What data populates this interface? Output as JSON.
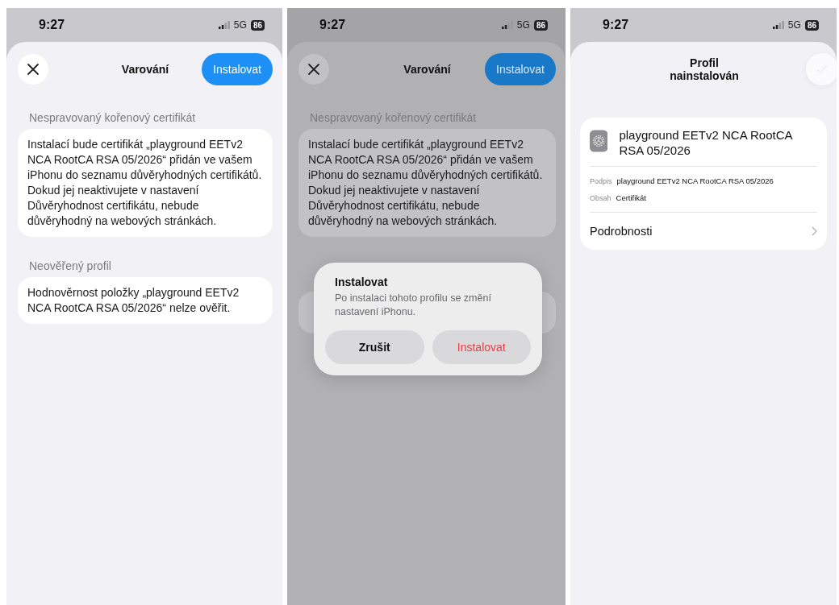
{
  "screens": [
    {
      "kind": "warning",
      "dimmed": false,
      "status": {
        "time": "9:27",
        "network": "5G",
        "battery": "86"
      },
      "title": "Varování",
      "install_button": "Instalovat",
      "sections": [
        {
          "header": "Nespravovaný kořenový certifikát",
          "text": "Instalací bude certifikát „playground EETv2 NCA RootCA RSA 05/2026“ přidán ve vašem iPhonu do seznamu důvěryhodných certifikátů. Dokud jej neaktivujete v nastavení Důvěryhodnost certifikátu, nebude důvěryhodný na webových stránkách."
        },
        {
          "header": "Neověřený profil",
          "text": "Hodnověrnost položky „playground EETv2 NCA RootCA RSA 05/2026“ nelze ověřit."
        }
      ]
    },
    {
      "kind": "warning",
      "dimmed": true,
      "status": {
        "time": "9:27",
        "network": "5G",
        "battery": "86"
      },
      "title": "Varování",
      "install_button": "Instalovat",
      "sections": [
        {
          "header": "Nespravovaný kořenový certifikát",
          "text": "Instalací bude certifikát „playground EETv2 NCA RootCA RSA 05/2026“ přidán ve vašem iPhonu do seznamu důvěryhodných certifikátů. Dokud jej neaktivujete v nastavení Důvěryhodnost certifikátu, nebude důvěryhodný na webových stránkách."
        }
      ],
      "alert": {
        "title": "Instalovat",
        "message": "Po instalaci tohoto profilu se změní nastavení iPhonu.",
        "buttons": [
          {
            "label": "Zrušit",
            "kind": "cancel"
          },
          {
            "label": "Instalovat",
            "kind": "destructive"
          }
        ]
      }
    },
    {
      "kind": "installed",
      "dimmed": false,
      "status": {
        "time": "9:27",
        "network": "5G",
        "battery": "86"
      },
      "title": "Profil nainstalován",
      "profile": {
        "name": "playground EETv2 NCA RootCA RSA 05/2026",
        "fields": [
          {
            "label": "Podpis",
            "value": "playground EETv2 NCA RootCA RSA 05/2026"
          },
          {
            "label": "Obsah",
            "value": "Certifikát"
          }
        ],
        "details": "Podrobnosti"
      }
    }
  ]
}
